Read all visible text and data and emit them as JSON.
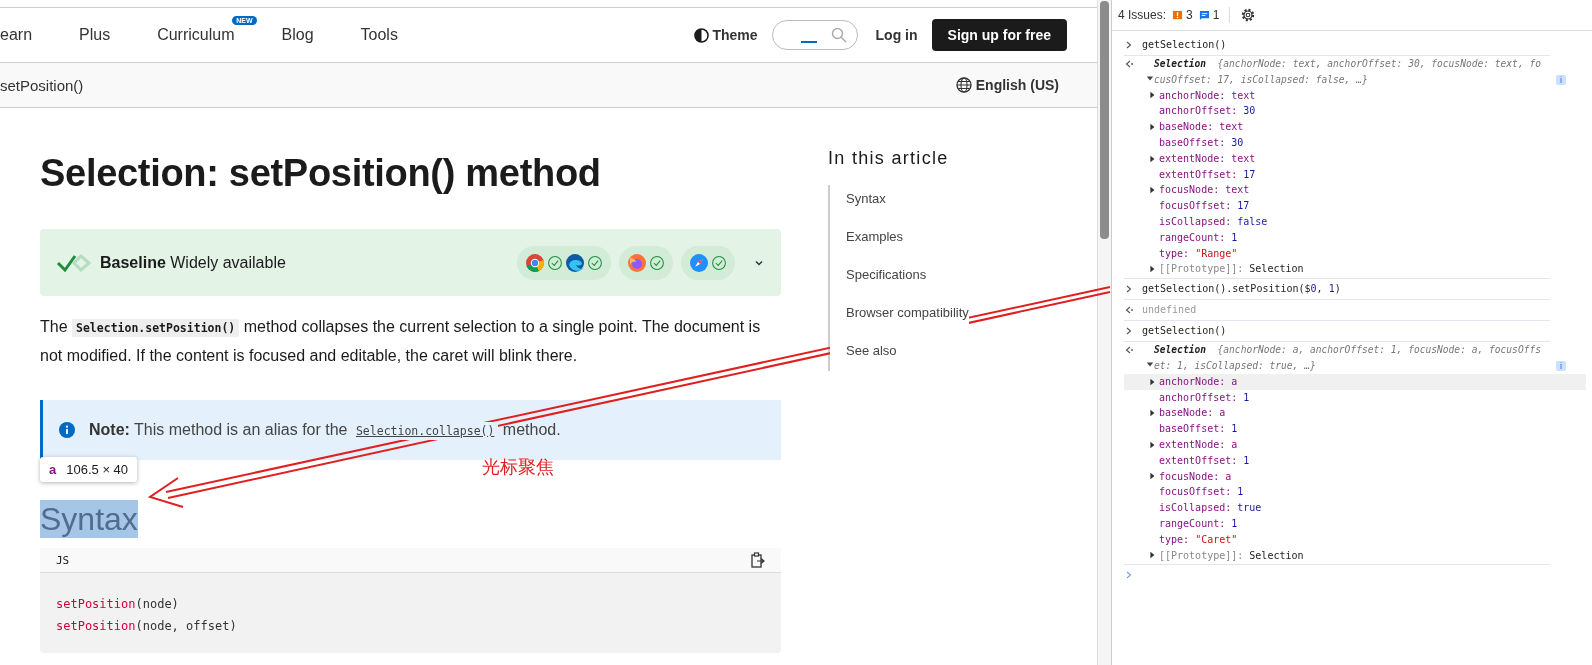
{
  "nav": {
    "items": [
      {
        "label": "earn"
      },
      {
        "label": "Plus"
      },
      {
        "label": "Curriculum",
        "badge": "NEW"
      },
      {
        "label": "Blog"
      },
      {
        "label": "Tools"
      }
    ],
    "theme": "Theme",
    "login": "Log in",
    "signup": "Sign up for free"
  },
  "breadcrumb": {
    "current": "setPosition()",
    "language": "English (US)"
  },
  "article": {
    "title": "Selection: setPosition() method",
    "baseline": {
      "label": "Baseline",
      "status": "Widely available",
      "browsers": [
        {
          "kind": "chrome-edge"
        },
        {
          "kind": "firefox"
        },
        {
          "kind": "safari"
        }
      ]
    },
    "intro_code": "Selection.setPosition()",
    "intro_rest": " method collapses the current selection to a single point. The document is not modified. If the content is focused and editable, the caret will blink there.",
    "intro_start": "The ",
    "note": {
      "label": "Note:",
      "text": " This method is an alias for the ",
      "code": "Selection.collapse()",
      "end": " method."
    },
    "tooltip": {
      "tag": "a",
      "size": "106.5 × 40"
    },
    "syntax_heading": {
      "text": "Syntax",
      "selected": true
    },
    "code": {
      "language": "JS",
      "lines": [
        {
          "fn": "setPosition",
          "args": "(node)"
        },
        {
          "fn": "setPosition",
          "args": "(node, offset)"
        }
      ]
    }
  },
  "toc": {
    "title": "In this article",
    "items": [
      "Syntax",
      "Examples",
      "Specifications",
      "Browser compatibility",
      "See also"
    ]
  },
  "annotation": {
    "text": "光标聚焦"
  },
  "devtools": {
    "issues": "4 Issues:",
    "errors": "3",
    "infos": "1",
    "console": [
      {
        "kind": "input",
        "text": "getSelection()"
      },
      {
        "kind": "object",
        "name": "Selection",
        "preview": "{anchorNode: text, anchorOffset: 30, focusNode: text, focusOffset: 17, isCollapsed: false,  …}",
        "badge": "i",
        "props": [
          {
            "key": "anchorNode:",
            "value": "text",
            "kind": "node",
            "hovered": false
          },
          {
            "key": "anchorOffset:",
            "value": "30",
            "kind": "number",
            "hovered": false
          },
          {
            "key": "baseNode:",
            "value": "text",
            "kind": "node",
            "hovered": false
          },
          {
            "key": "baseOffset:",
            "value": "30",
            "kind": "number",
            "hovered": false
          },
          {
            "key": "extentNode:",
            "value": "text",
            "kind": "node",
            "hovered": false
          },
          {
            "key": "extentOffset:",
            "value": "17",
            "kind": "number",
            "hovered": false
          },
          {
            "key": "focusNode:",
            "value": "text",
            "kind": "node",
            "hovered": false
          },
          {
            "key": "focusOffset:",
            "value": "17",
            "kind": "number",
            "hovered": false
          },
          {
            "key": "isCollapsed:",
            "value": "false",
            "kind": "number",
            "hovered": false
          },
          {
            "key": "rangeCount:",
            "value": "1",
            "kind": "number",
            "hovered": false
          },
          {
            "key": "type:",
            "value": "\"Range\"",
            "kind": "string",
            "hovered": false
          },
          {
            "key": "[[Prototype]]:",
            "value": "Selection",
            "kind": "proto",
            "hovered": false
          }
        ]
      },
      {
        "kind": "input",
        "text": "getSelection().setPosition($0, 1)"
      },
      {
        "kind": "undefined",
        "text": "undefined"
      },
      {
        "kind": "input",
        "text": "getSelection()"
      },
      {
        "kind": "object",
        "name": "Selection",
        "preview": "{anchorNode: a, anchorOffset: 1, focusNode: a, focusOffset: 1, isCollapsed: true,  …}",
        "badge": "i",
        "props": [
          {
            "key": "anchorNode:",
            "value": "a",
            "kind": "node",
            "hovered": true
          },
          {
            "key": "anchorOffset:",
            "value": "1",
            "kind": "number",
            "hovered": false
          },
          {
            "key": "baseNode:",
            "value": "a",
            "kind": "node",
            "hovered": false
          },
          {
            "key": "baseOffset:",
            "value": "1",
            "kind": "number",
            "hovered": false
          },
          {
            "key": "extentNode:",
            "value": "a",
            "kind": "node",
            "hovered": false
          },
          {
            "key": "extentOffset:",
            "value": "1",
            "kind": "number",
            "hovered": false
          },
          {
            "key": "focusNode:",
            "value": "a",
            "kind": "node",
            "hovered": false
          },
          {
            "key": "focusOffset:",
            "value": "1",
            "kind": "number",
            "hovered": false
          },
          {
            "key": "isCollapsed:",
            "value": "true",
            "kind": "number",
            "hovered": false
          },
          {
            "key": "rangeCount:",
            "value": "1",
            "kind": "number",
            "hovered": false
          },
          {
            "key": "type:",
            "value": "\"Caret\"",
            "kind": "string",
            "hovered": false
          },
          {
            "key": "[[Prototype]]:",
            "value": "Selection",
            "kind": "proto",
            "hovered": false
          }
        ]
      }
    ]
  }
}
